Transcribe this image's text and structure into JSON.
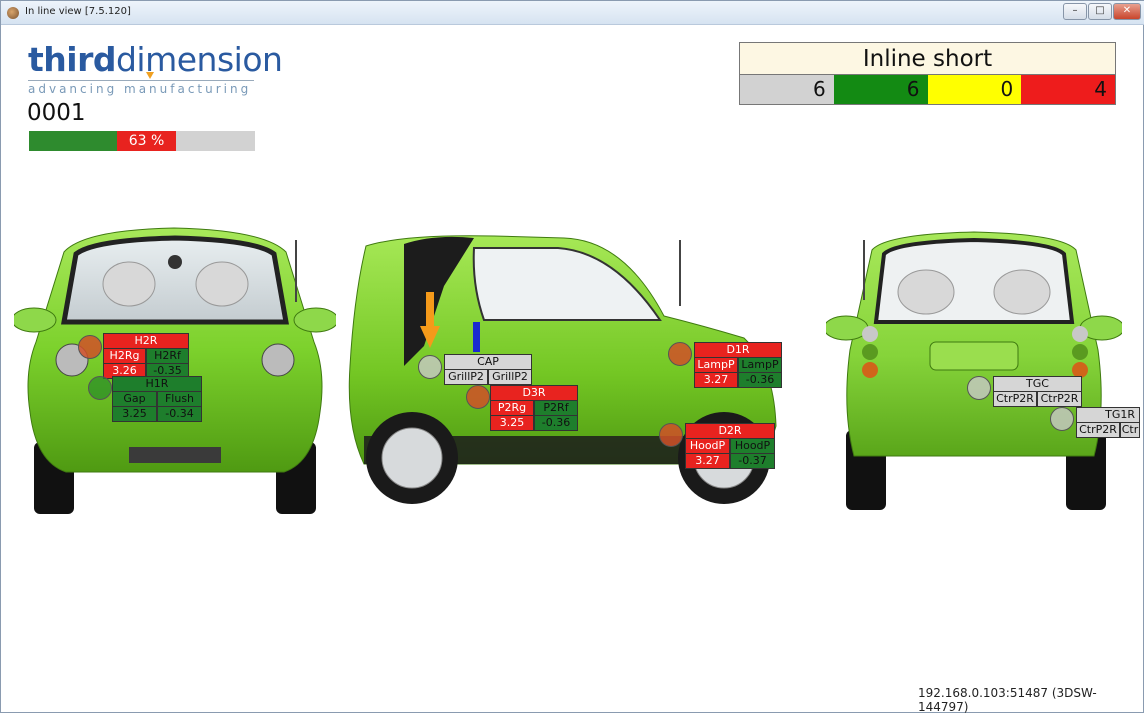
{
  "window": {
    "title": "In line view [7.5.120]"
  },
  "logo": {
    "brand_a": "third",
    "brand_b": "dimension",
    "tagline": "advancing manufacturing"
  },
  "counter": "0001",
  "progress": {
    "percent_label": "63 %",
    "green_fraction": 0.39,
    "red_fraction": 0.26
  },
  "summary": {
    "title": "Inline short",
    "counts": [
      {
        "value": "6",
        "color": "#d2d2d2"
      },
      {
        "value": "6",
        "color": "#138a13"
      },
      {
        "value": "0",
        "color": "#ffff00"
      },
      {
        "value": "4",
        "color": "#ee1c1c"
      }
    ]
  },
  "front": {
    "h2r": {
      "title": "H2R",
      "c1": "H2Rg",
      "c2": "H2Rf",
      "v1": "3.26",
      "v2": "-0.35"
    },
    "h1r": {
      "title": "H1R",
      "c1": "Gap",
      "c2": "Flush",
      "v1": "3.25",
      "v2": "-0.34"
    }
  },
  "side": {
    "cap": {
      "title": "CAP",
      "c1": "GrillP2",
      "c2": "GrillP2"
    },
    "d3r": {
      "title": "D3R",
      "c1": "P2Rg",
      "c2": "P2Rf",
      "v1": "3.25",
      "v2": "-0.36"
    },
    "d1r": {
      "title": "D1R",
      "c1": "LampP",
      "c2": "LampP",
      "v1": "3.27",
      "v2": "-0.36"
    },
    "d2r": {
      "title": "D2R",
      "c1": "HoodP",
      "c2": "HoodP",
      "v1": "3.27",
      "v2": "-0.37"
    }
  },
  "rear": {
    "tgc": {
      "title": "TGC",
      "c1": "CtrP2R",
      "c2": "CtrP2R"
    },
    "tg1r": {
      "title": "TG1R",
      "c1": "CtrP2R",
      "c2": "Ctr"
    }
  },
  "status_text": "192.168.0.103:51487 (3DSW-144797)"
}
